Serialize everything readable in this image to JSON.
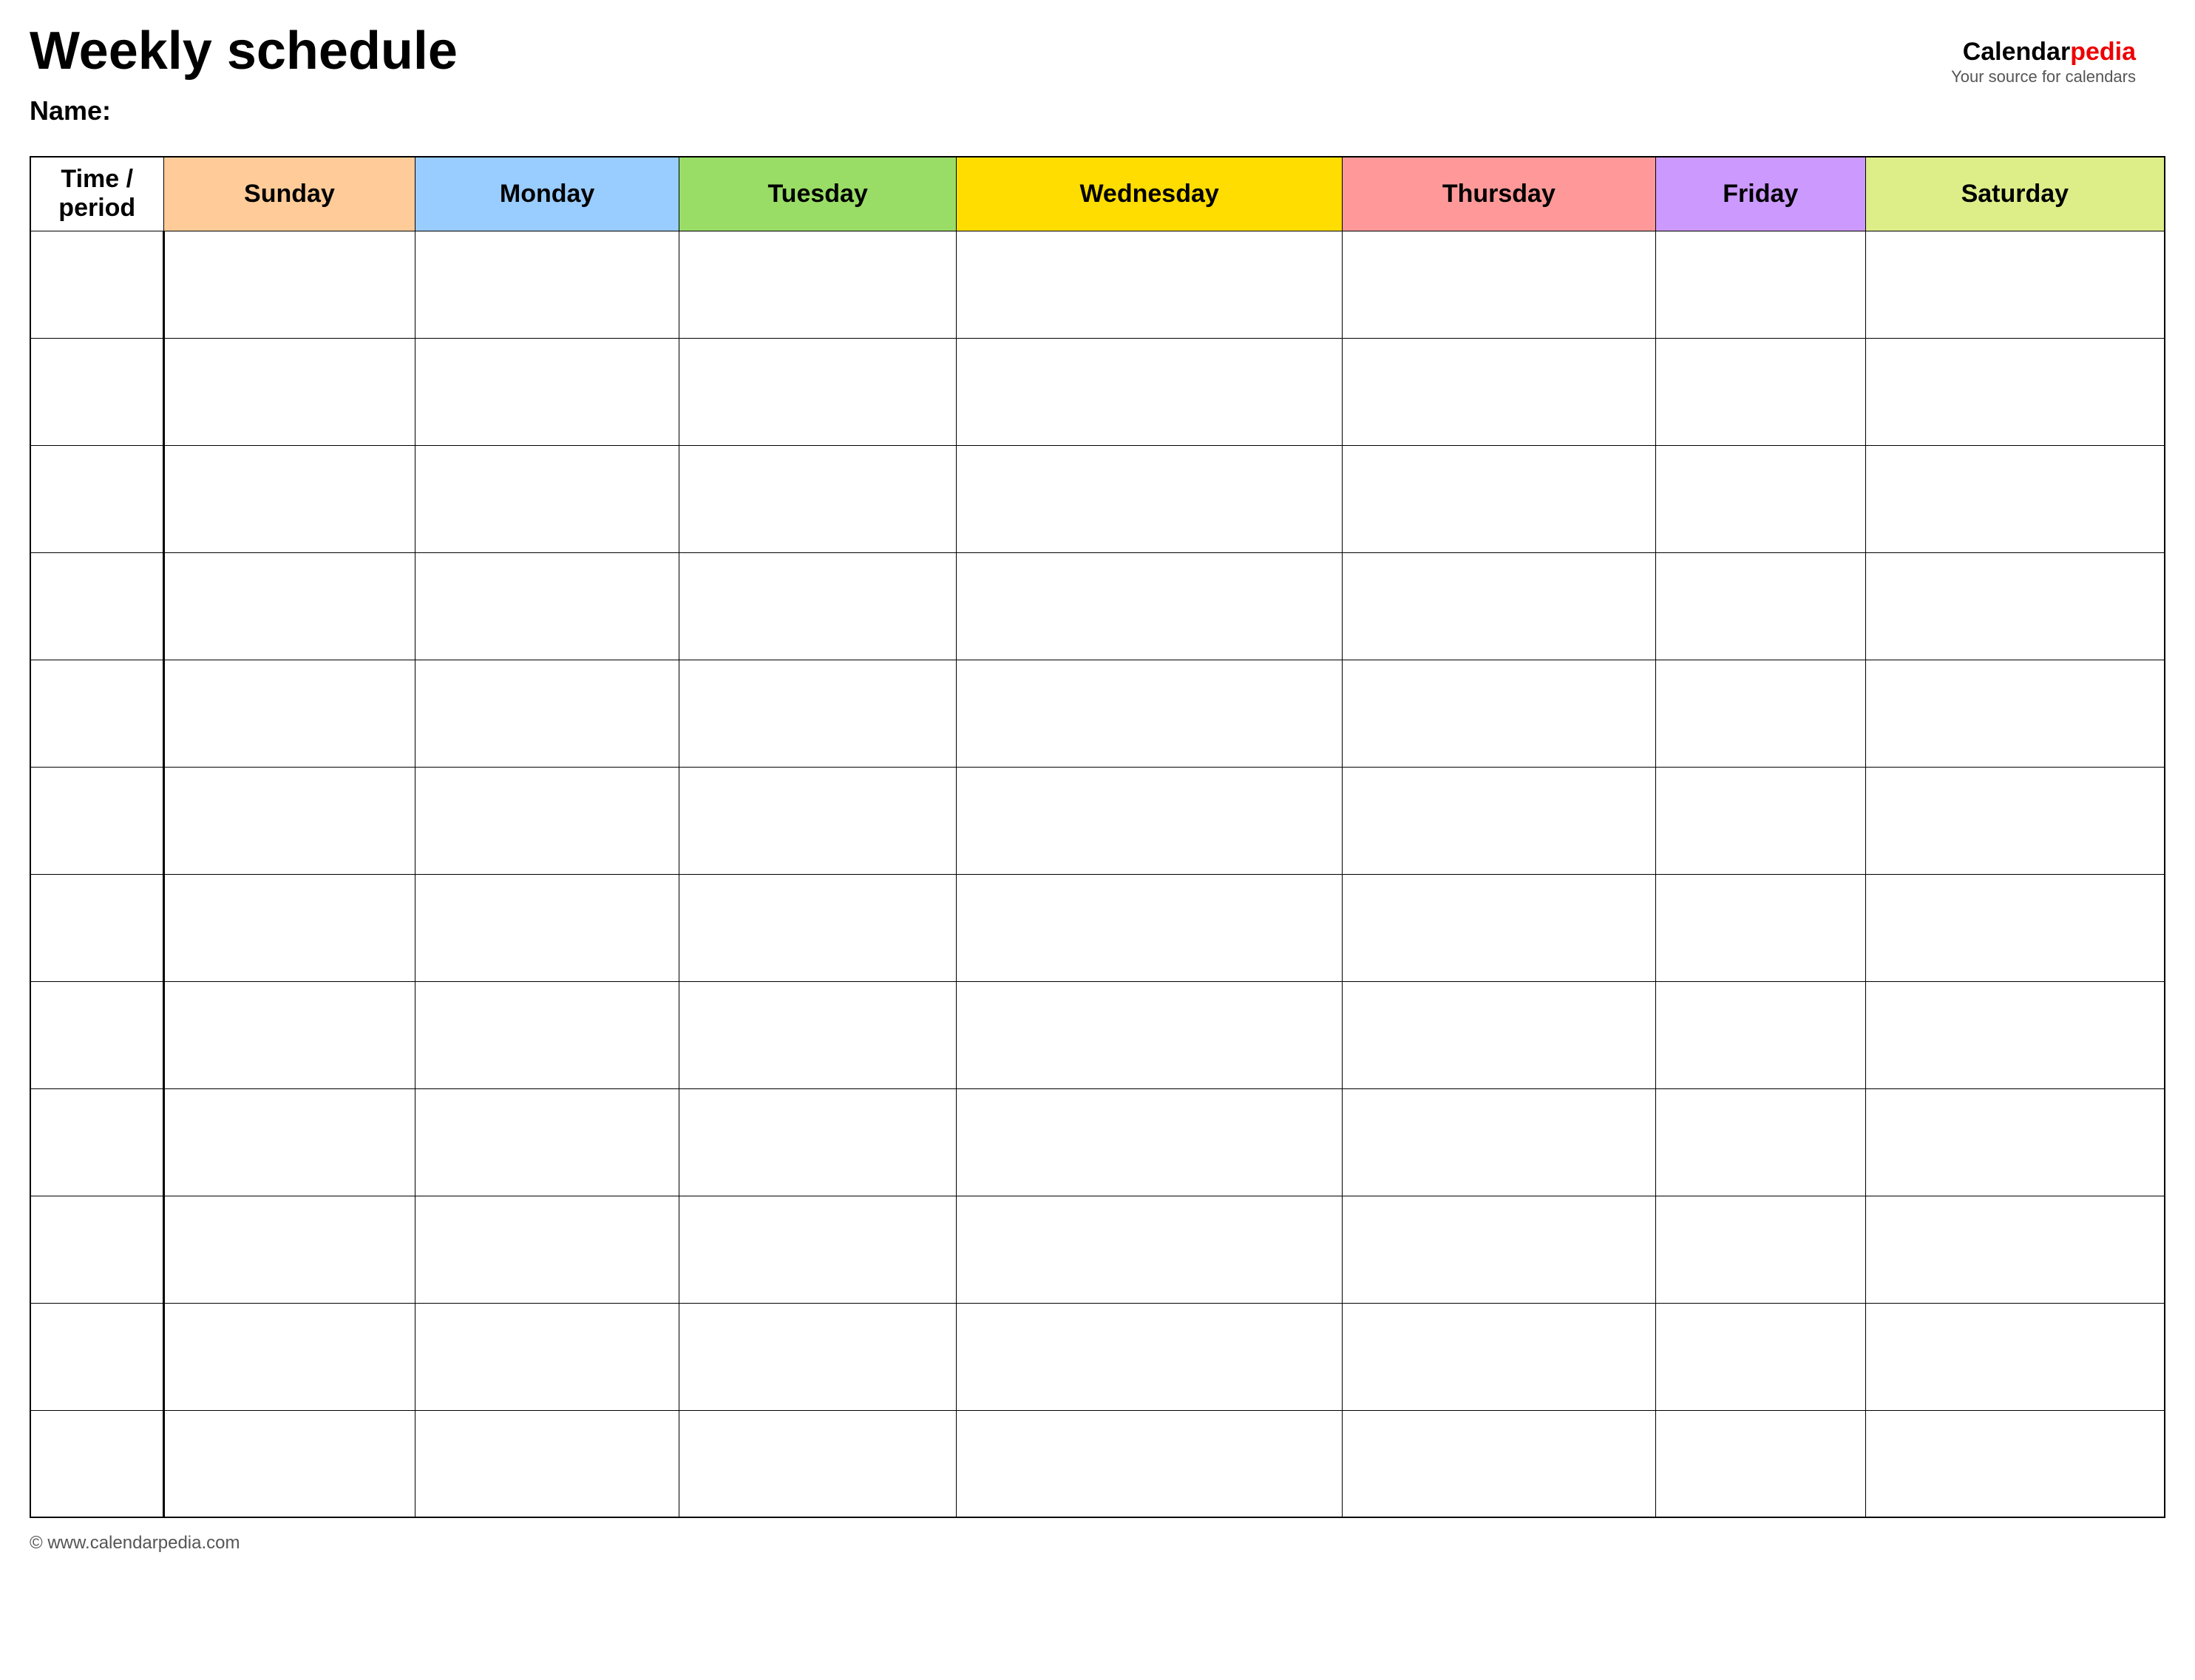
{
  "header": {
    "title": "Weekly schedule",
    "name_label": "Name:",
    "logo": {
      "brand_part1": "Calendar",
      "brand_part2": "pedia",
      "tagline": "Your source for calendars"
    }
  },
  "footer": {
    "url": "www.calendarpedia.com"
  },
  "table": {
    "columns": [
      {
        "id": "time",
        "label": "Time / period",
        "class": "col-time"
      },
      {
        "id": "sunday",
        "label": "Sunday",
        "class": "col-sunday"
      },
      {
        "id": "monday",
        "label": "Monday",
        "class": "col-monday"
      },
      {
        "id": "tuesday",
        "label": "Tuesday",
        "class": "col-tuesday"
      },
      {
        "id": "wednesday",
        "label": "Wednesday",
        "class": "col-wednesday"
      },
      {
        "id": "thursday",
        "label": "Thursday",
        "class": "col-thursday"
      },
      {
        "id": "friday",
        "label": "Friday",
        "class": "col-friday"
      },
      {
        "id": "saturday",
        "label": "Saturday",
        "class": "col-saturday"
      }
    ],
    "rows": 12
  }
}
